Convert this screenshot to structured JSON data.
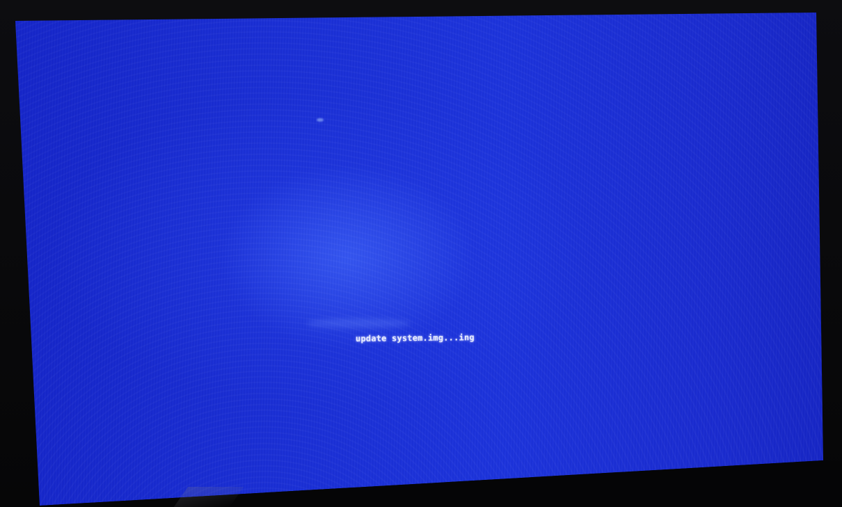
{
  "screen": {
    "background_color": "#1a2fd6",
    "status_message": "update system.img...ing",
    "text_color": "#e8ecff"
  }
}
